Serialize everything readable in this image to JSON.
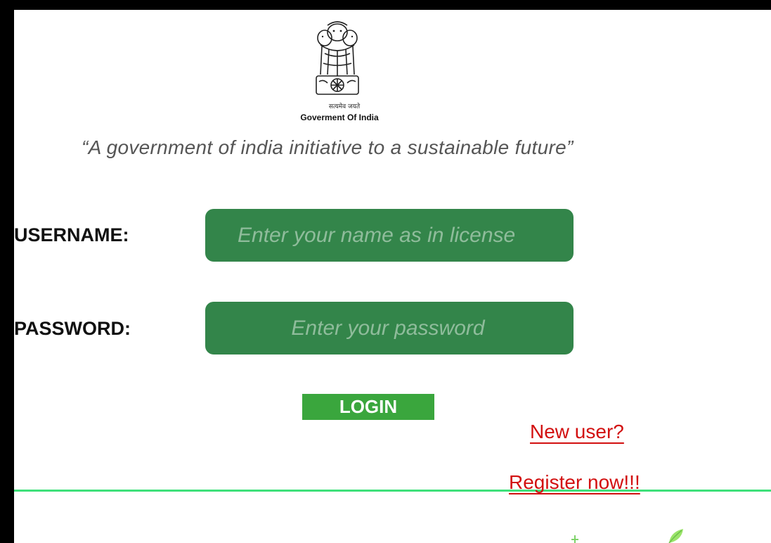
{
  "header": {
    "emblem_icon": "national-emblem-icon",
    "motto": "सत्यमेव जयते",
    "government": "Goverment Of India"
  },
  "tagline": "“A government of india initiative to a sustainable future”",
  "form": {
    "username_label": "USERNAME:",
    "username_placeholder": "Enter your name as in license",
    "password_label": "PASSWORD:",
    "password_placeholder": "Enter your password",
    "login_label": "LOGIN"
  },
  "links": {
    "new_user": "New user?",
    "register": "Register now!!!"
  },
  "colors": {
    "input_bg": "#33854a",
    "button_bg": "#3aa63d",
    "link": "#d21010",
    "divider": "#3ee07a"
  }
}
